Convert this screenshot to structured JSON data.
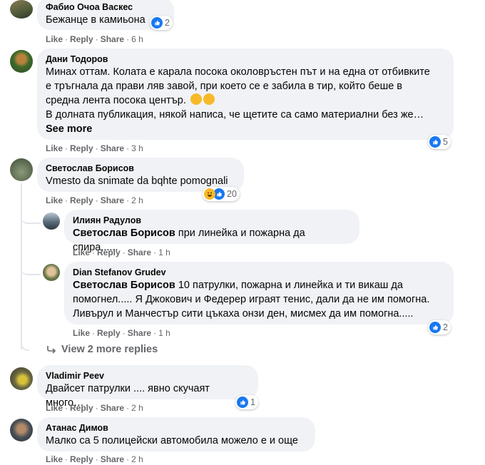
{
  "colors": {
    "bubble": "#f0f2f5",
    "meta": "#65676b",
    "like_blue": "#1877f2",
    "haha_yellow": "#f7b928"
  },
  "labels": {
    "like": "Like",
    "reply": "Reply",
    "share": "Share",
    "see_more": "See more",
    "view_more_replies": "View 2 more replies"
  },
  "comments": [
    {
      "author": "Фабио Очоа Васкес",
      "text": "Бежанце в камиьона",
      "time": "6 h",
      "reactions": {
        "icons": [
          "like-icon"
        ],
        "count": "2"
      }
    },
    {
      "author": "Дани Тодоров",
      "lines": [
        "Минах оттам. Колата е карала посока околовръстен път и на една от отбивките",
        "е тръгнала да прави ляв завой, при което се е забила в тир, който беше в",
        "средна лента посока център."
      ],
      "line2": "В долната публикация, някой написа, че щетите са само материални без же…",
      "time": "3 h",
      "reactions": {
        "icons": [
          "like-icon"
        ],
        "count": "5"
      }
    },
    {
      "author": "Светослав Борисов",
      "text": "Vmesto da snimate da bqhte pomognali",
      "time": "2 h",
      "reactions": {
        "icons": [
          "haha-icon",
          "like-icon"
        ],
        "count": "20"
      }
    },
    {
      "author": "Vladimir Peev",
      "text": "Двайсет патрулки .... явно скучаят много…",
      "time": "2 h",
      "reactions": {
        "icons": [
          "like-icon"
        ],
        "count": "1"
      }
    },
    {
      "author": "Атанас Димов",
      "text": "Малко са 5 полицейски автомобила можело е и още",
      "time": "2 h"
    }
  ],
  "replies": [
    {
      "author": "Илиян Радулов",
      "mention": "Светослав Борисов",
      "text": " при линейка и пожарна да спира......",
      "time": "1 h"
    },
    {
      "author": "Dian Stefanov Grudev",
      "mention": "Светослав Борисов",
      "text_first": " 10 патрулки, пожарна и линейка и ти викаш да",
      "lines": [
        "помогнел..... Я Джокович и Федерер играят тенис, дали да не им помогна.",
        "Ливърул и Манчестър сити цъкаха онзи ден, мисмех да им помогна....."
      ],
      "time": "1 h",
      "reactions": {
        "icons": [
          "like-icon"
        ],
        "count": "2"
      }
    }
  ]
}
